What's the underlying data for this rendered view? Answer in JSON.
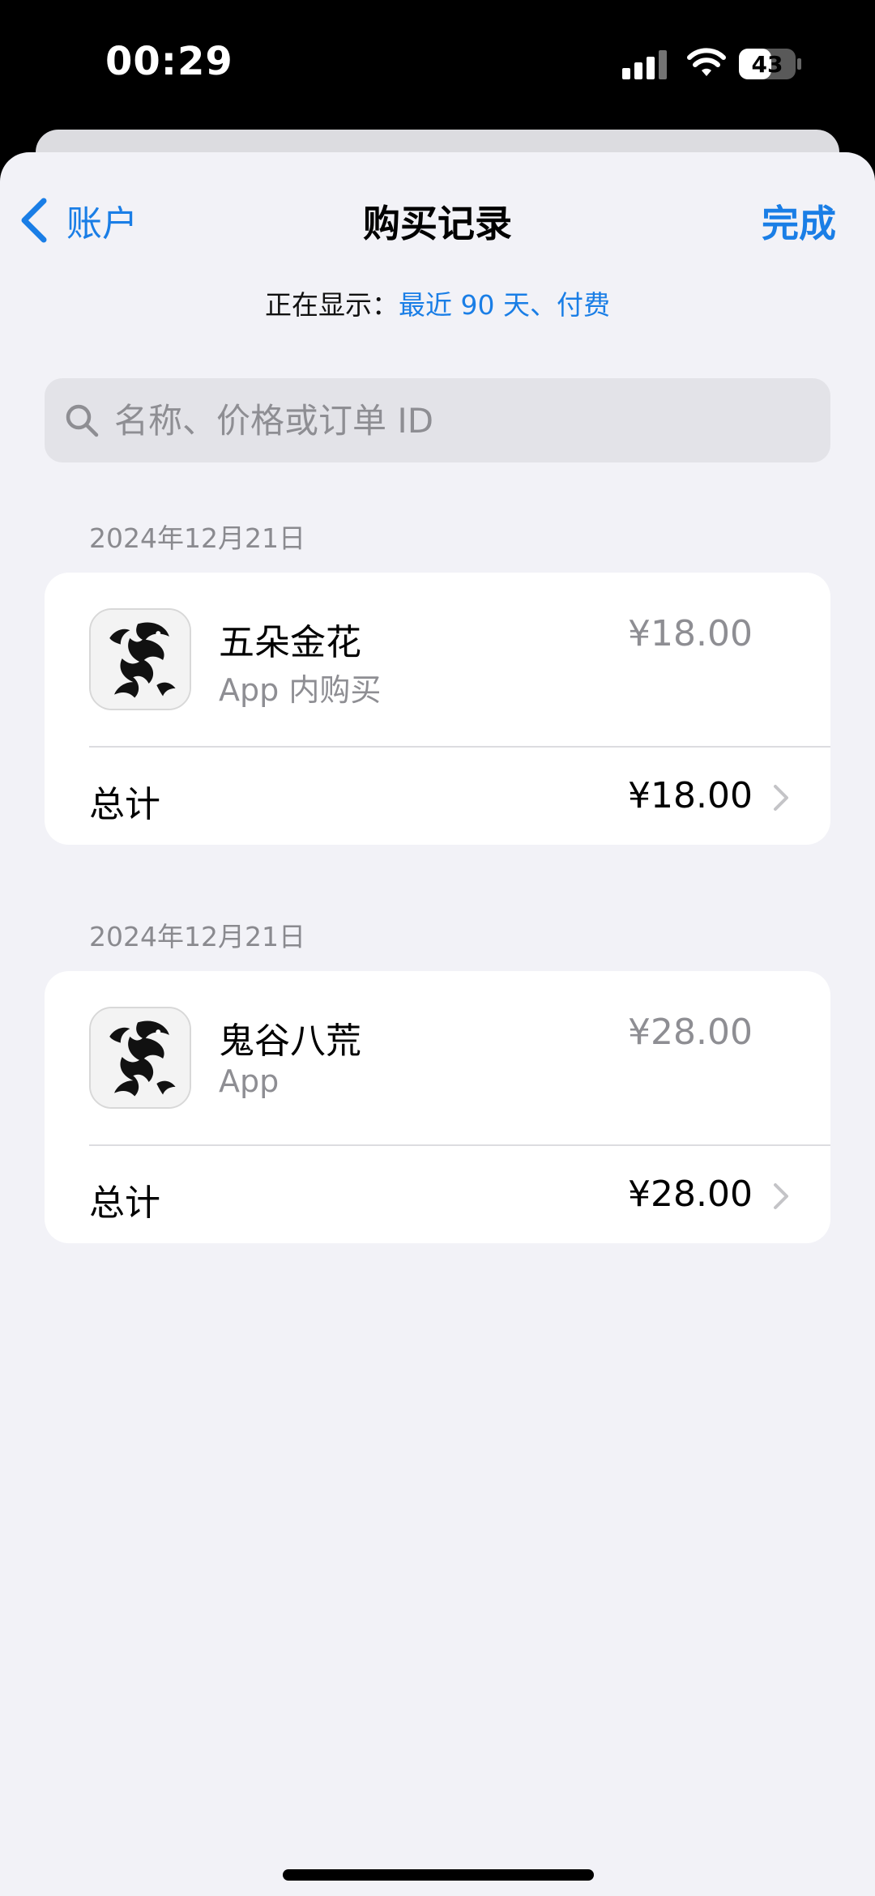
{
  "status_bar": {
    "time": "00:29",
    "battery": "43"
  },
  "nav": {
    "back_label": "账户",
    "title": "购买记录",
    "done_label": "完成"
  },
  "filter": {
    "prefix": "正在显示：",
    "value": "最近 90 天、付费"
  },
  "search": {
    "placeholder": "名称、价格或订单 ID",
    "value": ""
  },
  "purchases": [
    {
      "date": "2024年12月21日",
      "item_name": "五朵金花",
      "item_type": "App 内购买",
      "item_price": "¥18.00",
      "total_label": "总计",
      "total_value": "¥18.00"
    },
    {
      "date": "2024年12月21日",
      "item_name": "鬼谷八荒",
      "item_type": "App",
      "item_price": "¥28.00",
      "total_label": "总计",
      "total_value": "¥28.00"
    }
  ],
  "colors": {
    "accent": "#1a7ee6",
    "background": "#f2f2f7",
    "secondary_text": "#8e8e93"
  },
  "icons": {
    "back": "chevron-left-icon",
    "search": "search-icon",
    "row": "chevron-right-icon",
    "app": "dragon-app-icon"
  }
}
